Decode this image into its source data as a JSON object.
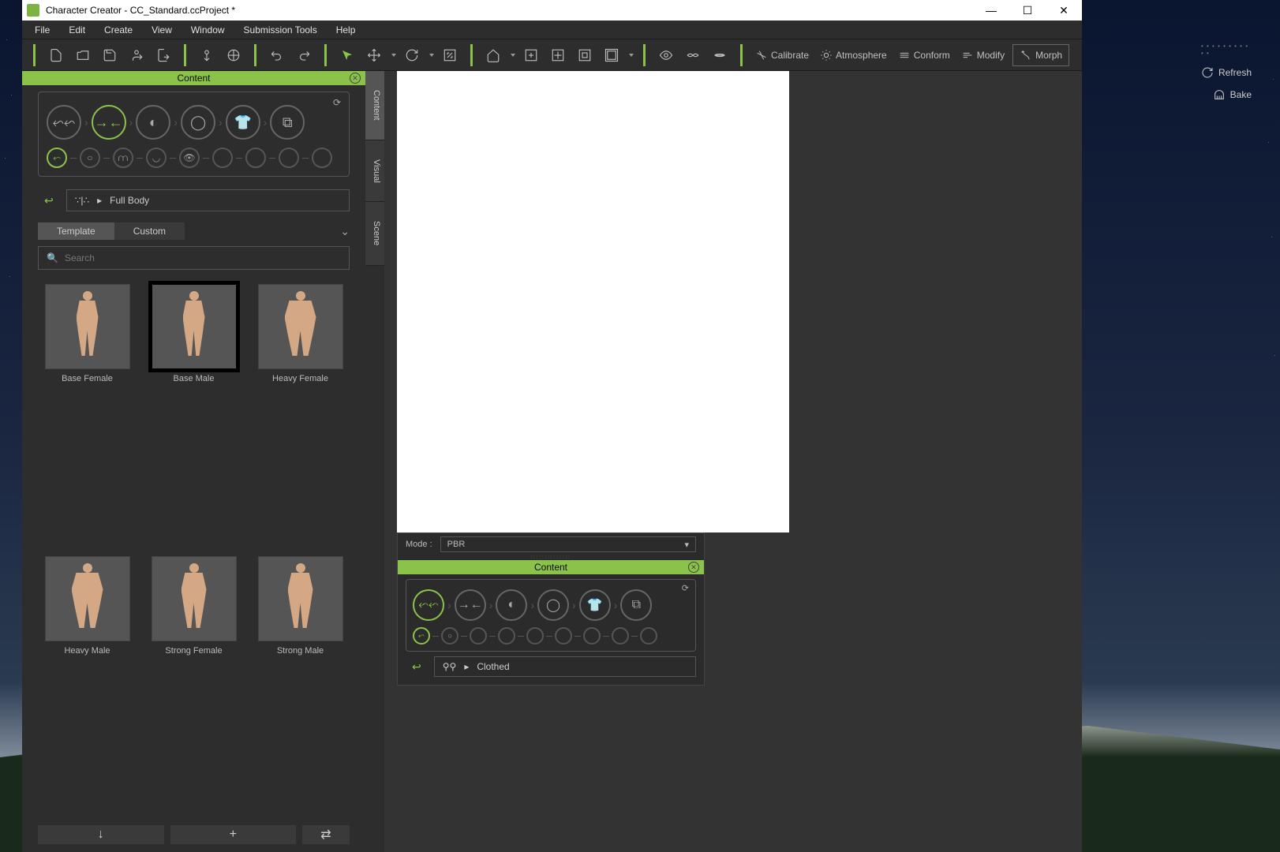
{
  "title": "Character Creator - CC_Standard.ccProject *",
  "menubar": [
    "File",
    "Edit",
    "Create",
    "View",
    "Window",
    "Submission Tools",
    "Help"
  ],
  "toolbar_actions": {
    "calibrate": "Calibrate",
    "atmosphere": "Atmosphere",
    "conform": "Conform",
    "modify": "Modify",
    "morph": "Morph"
  },
  "panel": {
    "title": "Content",
    "breadcrumb_icon": "∵|∴",
    "breadcrumb": "Full Body",
    "tabs": [
      "Template",
      "Custom"
    ],
    "search_placeholder": "Search",
    "templates": [
      {
        "label": "Base Female",
        "variant": "base",
        "selected": false
      },
      {
        "label": "Base Male",
        "variant": "base",
        "selected": true
      },
      {
        "label": "Heavy Female",
        "variant": "heavy",
        "selected": false
      },
      {
        "label": "Heavy Male",
        "variant": "heavy",
        "selected": false
      },
      {
        "label": "Strong Female",
        "variant": "strong",
        "selected": false
      },
      {
        "label": "Strong Male",
        "variant": "strong",
        "selected": false
      }
    ]
  },
  "sidetabs": [
    "Content",
    "Visual",
    "Scene"
  ],
  "float_panel": {
    "mode_label": "Mode :",
    "mode_value": "PBR",
    "title": "Content",
    "breadcrumb_icon": "⚲⚲",
    "breadcrumb": "Clothed"
  },
  "right": {
    "refresh": "Refresh",
    "bake": "Bake"
  }
}
